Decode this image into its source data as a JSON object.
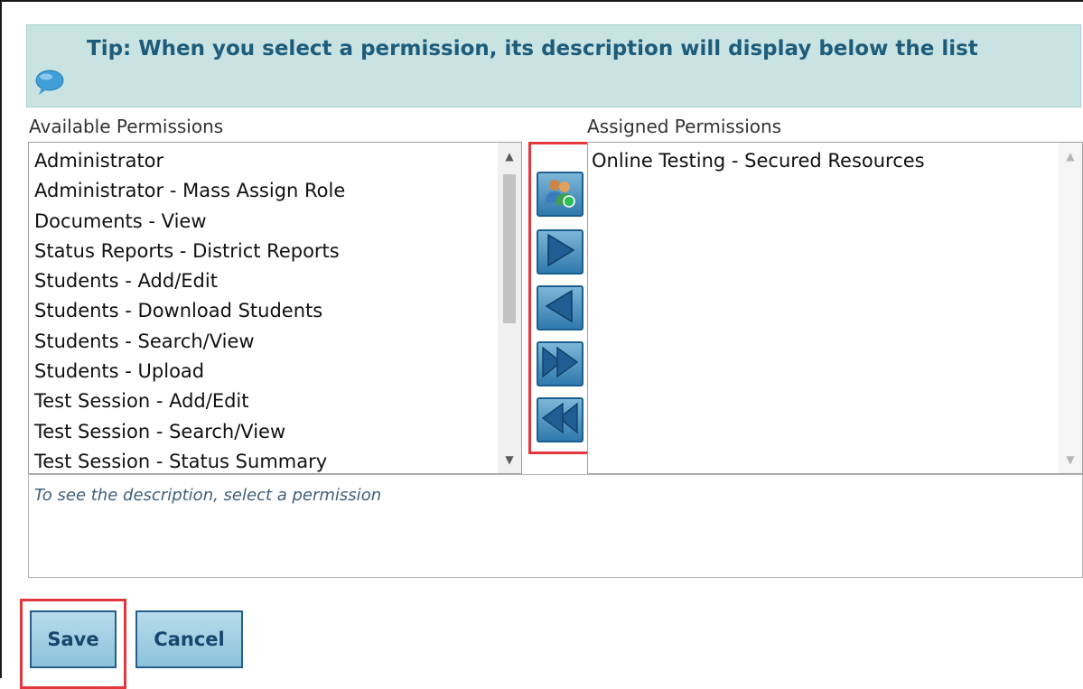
{
  "tip": {
    "text": "Tip: When you select a permission, its description will display below the list",
    "icon": "speech-bubble-icon"
  },
  "available": {
    "label": "Available Permissions",
    "items": [
      "Administrator",
      "Administrator - Mass Assign Role",
      "Documents - View",
      "Status Reports - District Reports",
      "Students - Add/Edit",
      "Students - Download Students",
      "Students - Search/View",
      "Students - Upload",
      "Test Session - Add/Edit",
      "Test Session - Search/View",
      "Test Session - Status Summary"
    ]
  },
  "assigned": {
    "label": "Assigned Permissions",
    "items": [
      "Online Testing - Secured Resources"
    ]
  },
  "move_buttons": [
    {
      "icon": "users-add-icon"
    },
    {
      "icon": "arrow-right-icon"
    },
    {
      "icon": "arrow-left-icon"
    },
    {
      "icon": "double-arrow-right-icon"
    },
    {
      "icon": "double-arrow-left-icon"
    }
  ],
  "description": {
    "placeholder": "To see the description, select a permission"
  },
  "buttons": {
    "save": "Save",
    "cancel": "Cancel"
  },
  "colors": {
    "tip_bg": "#c9e3e3",
    "tip_text": "#1d5c7a",
    "highlight": "#e2373d",
    "button_fill": "#8cc2da"
  }
}
